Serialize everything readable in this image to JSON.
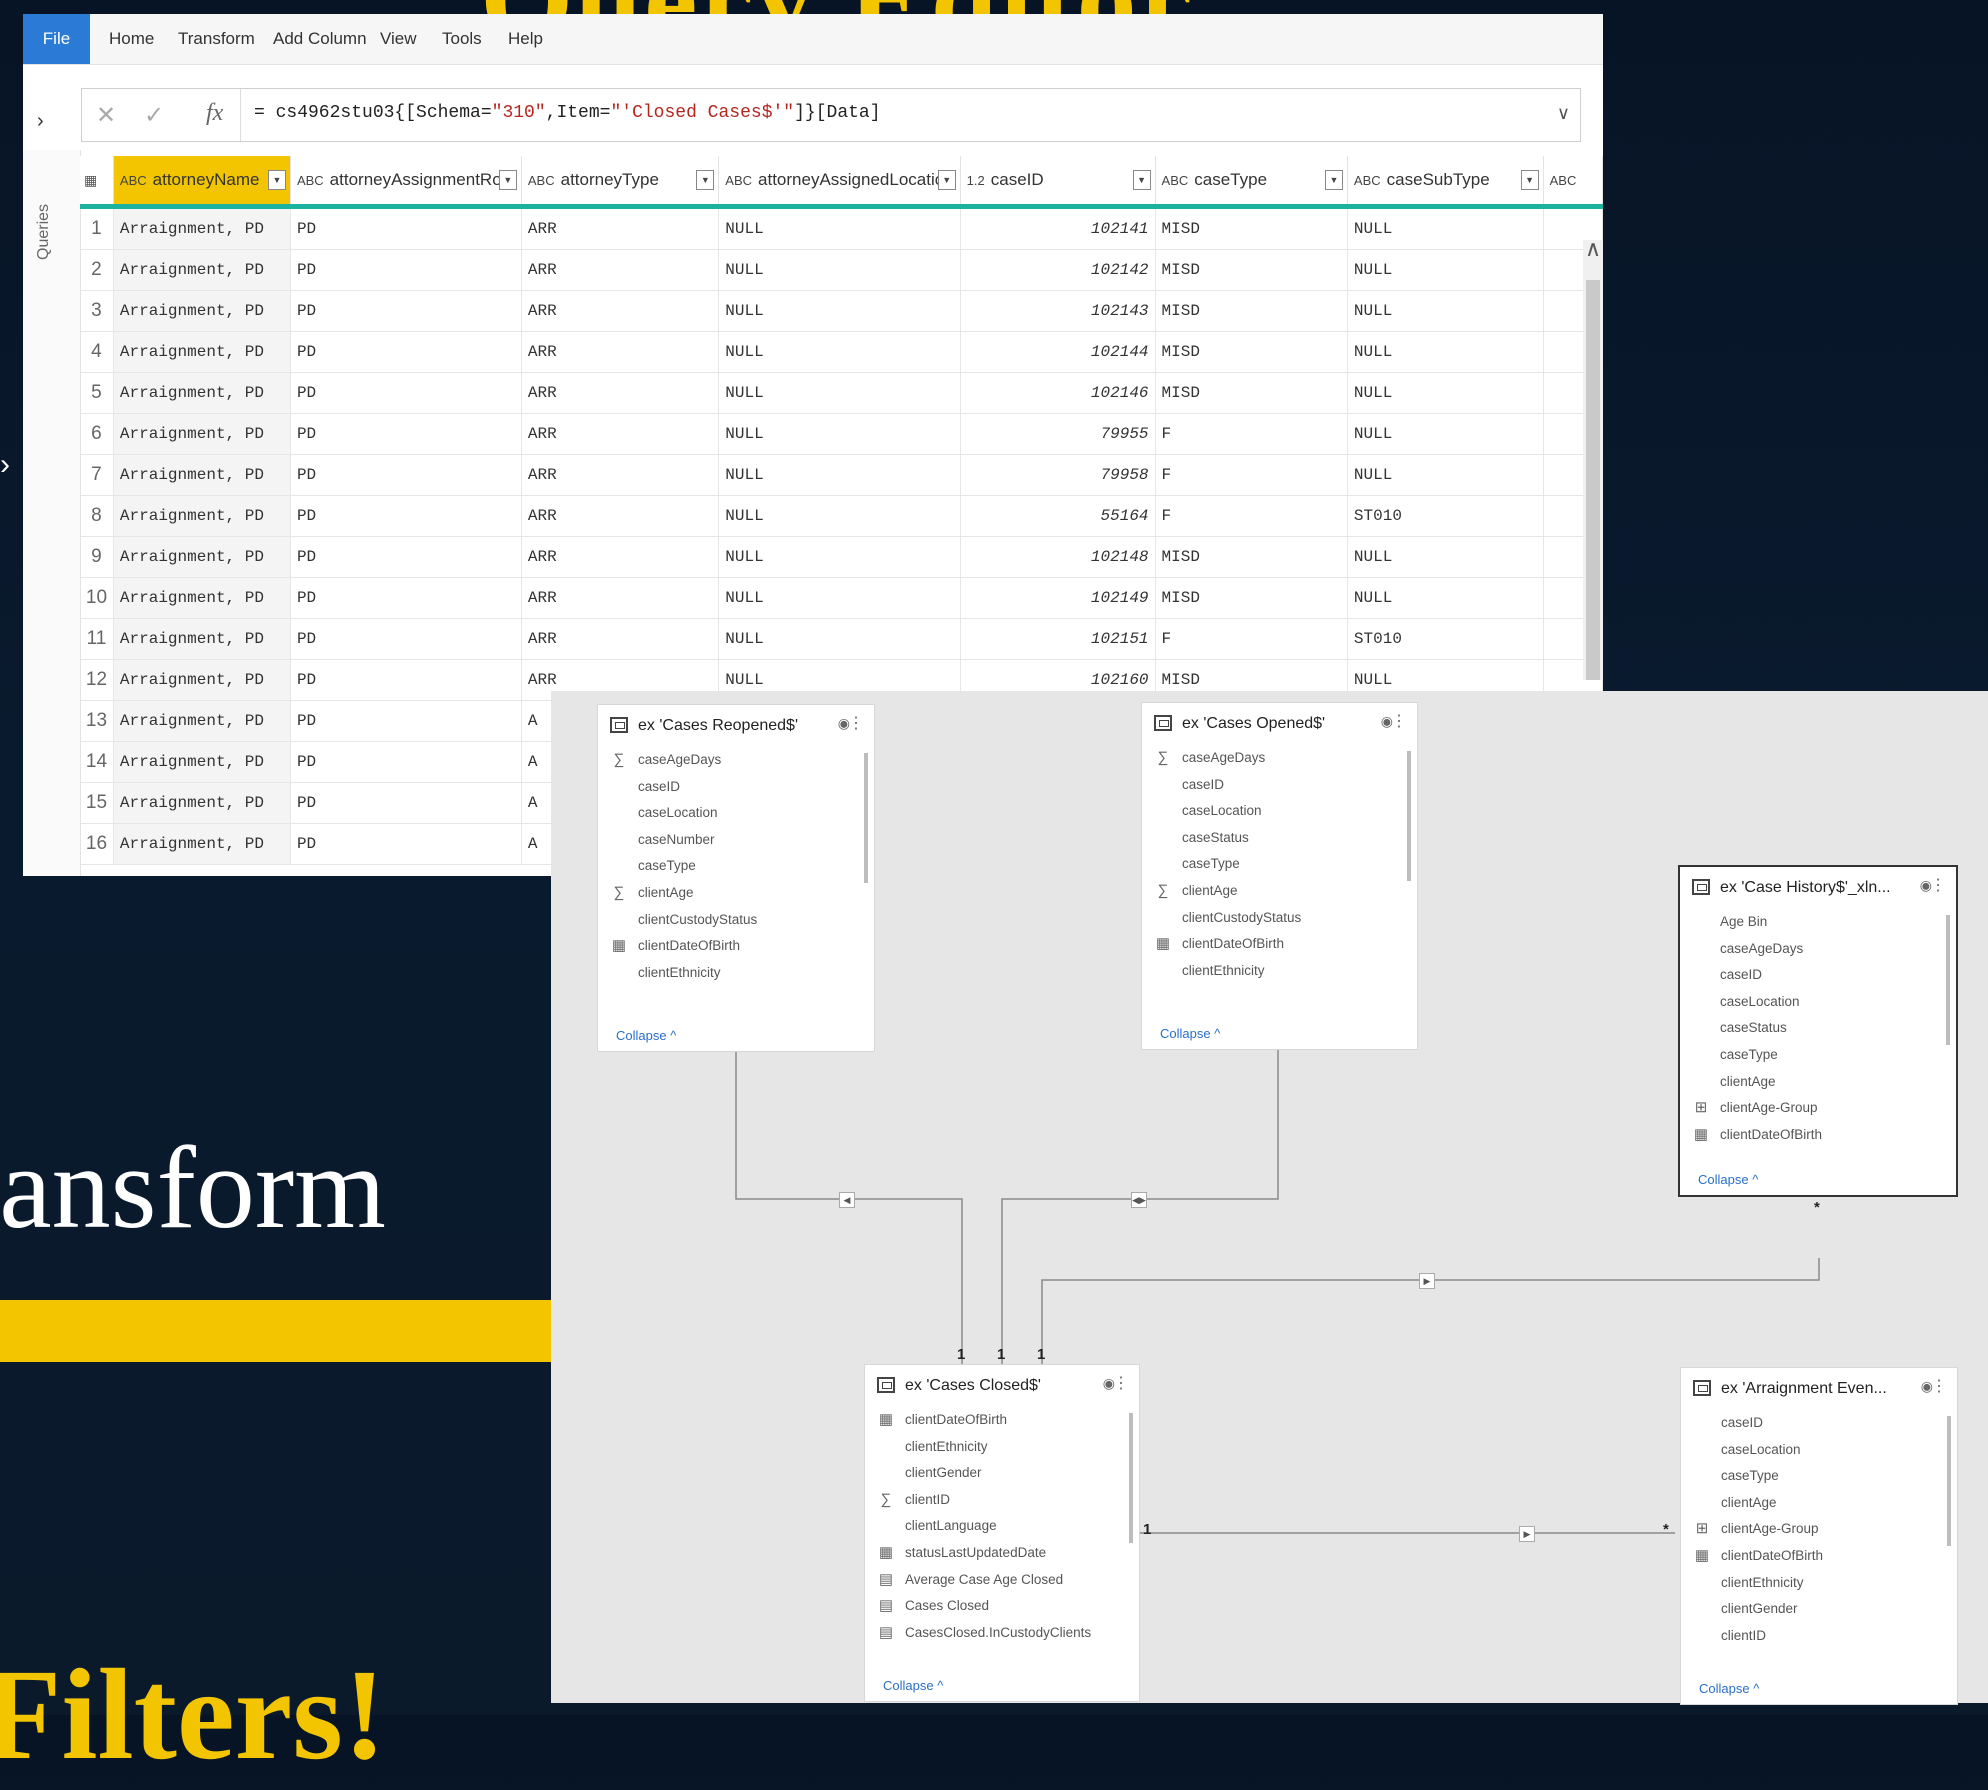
{
  "slide": {
    "title_fragment": "Query Editor",
    "transform_fragment": "ransform",
    "filters_fragment": "Filters!"
  },
  "colors": {
    "accent_yellow": "#f2c500",
    "teal": "#1bb3a0",
    "file_blue": "#2a7ad6"
  },
  "ribbon": {
    "tabs": [
      "File",
      "Home",
      "Transform",
      "Add Column",
      "View",
      "Tools",
      "Help"
    ]
  },
  "formula_bar": {
    "cancel_icon": "x-icon",
    "commit_icon": "check-icon",
    "fx": "fx",
    "formula_prefix": "= cs4962stu03{[Schema=",
    "schema_value": "\"310\"",
    "item_prefix": ",Item=",
    "item_value": "\"'Closed Cases$'\"",
    "formula_suffix": "]}[Data]"
  },
  "queries_pane": {
    "label": "Queries"
  },
  "grid": {
    "columns": [
      {
        "type": "ABC",
        "name": "attorneyName"
      },
      {
        "type": "ABC",
        "name": "attorneyAssignmentRole"
      },
      {
        "type": "ABC",
        "name": "attorneyType"
      },
      {
        "type": "ABC",
        "name": "attorneyAssignedLocation"
      },
      {
        "type": "1.2",
        "name": "caseID"
      },
      {
        "type": "ABC",
        "name": "caseType"
      },
      {
        "type": "ABC",
        "name": "caseSubType"
      },
      {
        "type": "ABC",
        "name": ""
      }
    ],
    "rows": [
      [
        "1",
        "Arraignment, PD",
        "PD",
        "ARR",
        "NULL",
        "102141",
        "MISD",
        "NULL"
      ],
      [
        "2",
        "Arraignment, PD",
        "PD",
        "ARR",
        "NULL",
        "102142",
        "MISD",
        "NULL"
      ],
      [
        "3",
        "Arraignment, PD",
        "PD",
        "ARR",
        "NULL",
        "102143",
        "MISD",
        "NULL"
      ],
      [
        "4",
        "Arraignment, PD",
        "PD",
        "ARR",
        "NULL",
        "102144",
        "MISD",
        "NULL"
      ],
      [
        "5",
        "Arraignment, PD",
        "PD",
        "ARR",
        "NULL",
        "102146",
        "MISD",
        "NULL"
      ],
      [
        "6",
        "Arraignment, PD",
        "PD",
        "ARR",
        "NULL",
        "79955",
        "F",
        "NULL"
      ],
      [
        "7",
        "Arraignment, PD",
        "PD",
        "ARR",
        "NULL",
        "79958",
        "F",
        "NULL"
      ],
      [
        "8",
        "Arraignment, PD",
        "PD",
        "ARR",
        "NULL",
        "55164",
        "F",
        "ST010"
      ],
      [
        "9",
        "Arraignment, PD",
        "PD",
        "ARR",
        "NULL",
        "102148",
        "MISD",
        "NULL"
      ],
      [
        "10",
        "Arraignment, PD",
        "PD",
        "ARR",
        "NULL",
        "102149",
        "MISD",
        "NULL"
      ],
      [
        "11",
        "Arraignment, PD",
        "PD",
        "ARR",
        "NULL",
        "102151",
        "F",
        "ST010"
      ],
      [
        "12",
        "Arraignment, PD",
        "PD",
        "ARR",
        "NULL",
        "102160",
        "MISD",
        "NULL"
      ],
      [
        "13",
        "Arraignment, PD",
        "PD",
        "A",
        "",
        "",
        "",
        ""
      ],
      [
        "14",
        "Arraignment, PD",
        "PD",
        "A",
        "",
        "",
        "",
        ""
      ],
      [
        "15",
        "Arraignment, PD",
        "PD",
        "A",
        "",
        "",
        "",
        ""
      ],
      [
        "16",
        "Arraignment, PD",
        "PD",
        "A",
        "",
        "",
        "",
        ""
      ]
    ]
  },
  "model": {
    "collapse_label": "Collapse",
    "tables": {
      "reopened": {
        "title": "ex 'Cases Reopened$'",
        "fields": [
          {
            "icon": "sigma-icon",
            "name": "caseAgeDays"
          },
          {
            "icon": "",
            "name": "caseID"
          },
          {
            "icon": "",
            "name": "caseLocation"
          },
          {
            "icon": "",
            "name": "caseNumber"
          },
          {
            "icon": "",
            "name": "caseType"
          },
          {
            "icon": "sigma-icon",
            "name": "clientAge"
          },
          {
            "icon": "",
            "name": "clientCustodyStatus"
          },
          {
            "icon": "calendar-icon",
            "name": "clientDateOfBirth"
          },
          {
            "icon": "",
            "name": "clientEthnicity"
          }
        ]
      },
      "opened": {
        "title": "ex 'Cases Opened$'",
        "fields": [
          {
            "icon": "sigma-icon",
            "name": "caseAgeDays"
          },
          {
            "icon": "",
            "name": "caseID"
          },
          {
            "icon": "",
            "name": "caseLocation"
          },
          {
            "icon": "",
            "name": "caseStatus"
          },
          {
            "icon": "",
            "name": "caseType"
          },
          {
            "icon": "sigma-icon",
            "name": "clientAge"
          },
          {
            "icon": "",
            "name": "clientCustodyStatus"
          },
          {
            "icon": "calendar-icon",
            "name": "clientDateOfBirth"
          },
          {
            "icon": "",
            "name": "clientEthnicity"
          }
        ]
      },
      "history": {
        "title": "ex 'Case History$'_xln...",
        "fields": [
          {
            "icon": "",
            "name": "Age Bin"
          },
          {
            "icon": "",
            "name": "caseAgeDays"
          },
          {
            "icon": "",
            "name": "caseID"
          },
          {
            "icon": "",
            "name": "caseLocation"
          },
          {
            "icon": "",
            "name": "caseStatus"
          },
          {
            "icon": "",
            "name": "caseType"
          },
          {
            "icon": "",
            "name": "clientAge"
          },
          {
            "icon": "hierarchy-icon",
            "name": "clientAge-Group"
          },
          {
            "icon": "calendar-icon",
            "name": "clientDateOfBirth"
          }
        ]
      },
      "closed": {
        "title": "ex 'Cases Closed$'",
        "fields": [
          {
            "icon": "calendar-icon",
            "name": "clientDateOfBirth"
          },
          {
            "icon": "",
            "name": "clientEthnicity"
          },
          {
            "icon": "",
            "name": "clientGender"
          },
          {
            "icon": "sigma-icon",
            "name": "clientID"
          },
          {
            "icon": "",
            "name": "clientLanguage"
          },
          {
            "icon": "calendar-icon",
            "name": "statusLastUpdatedDate"
          },
          {
            "icon": "measure-icon",
            "name": "Average Case Age Closed"
          },
          {
            "icon": "measure-icon",
            "name": "Cases Closed"
          },
          {
            "icon": "measure-icon",
            "name": "CasesClosed.InCustodyClients"
          }
        ]
      },
      "arraignment": {
        "title": "ex 'Arraignment Even...",
        "fields": [
          {
            "icon": "",
            "name": "caseID"
          },
          {
            "icon": "",
            "name": "caseLocation"
          },
          {
            "icon": "",
            "name": "caseType"
          },
          {
            "icon": "",
            "name": "clientAge"
          },
          {
            "icon": "hierarchy-icon",
            "name": "clientAge-Group"
          },
          {
            "icon": "calendar-icon",
            "name": "clientDateOfBirth"
          },
          {
            "icon": "",
            "name": "clientEthnicity"
          },
          {
            "icon": "",
            "name": "clientGender"
          },
          {
            "icon": "",
            "name": "clientID"
          }
        ]
      }
    },
    "cardinality": {
      "reopened": "*",
      "opened": "1",
      "history": "*",
      "arraignment": "*",
      "closed_a": "1",
      "closed_b": "1",
      "closed_c": "1",
      "closed_right": "1"
    }
  }
}
